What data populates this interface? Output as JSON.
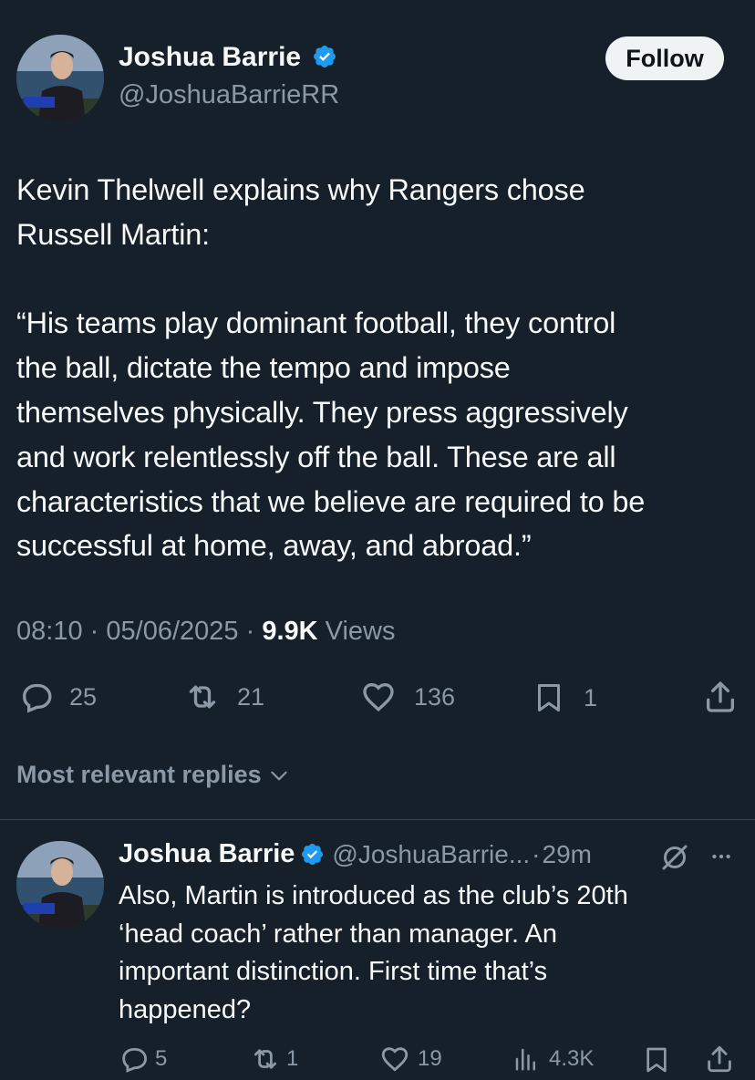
{
  "tweet": {
    "author_name": "Joshua Barrie",
    "author_handle": "@JoshuaBarrieRR",
    "follow_label": "Follow",
    "text": "Kevin Thelwell explains why Rangers chose\nRussell Martin:\n\n“His teams play dominant football, they control\nthe ball, dictate the tempo and impose\nthemselves physically. They press aggressively\nand work relentlessly off the ball. These are all\ncharacteristics that we believe are required to be\nsuccessful at home, away, and abroad.”",
    "time": "08:10",
    "date": "05/06/2025",
    "separator": "·",
    "views_count": "9.9K",
    "views_label": "Views",
    "replies": "25",
    "reposts": "21",
    "likes": "136",
    "bookmarks": "1",
    "avatar_caption": "Joshua Barrie"
  },
  "replies_filter": {
    "label": "Most relevant replies"
  },
  "reply": {
    "author_name": "Joshua Barrie",
    "author_handle": "@JoshuaBarrie...",
    "separator": "·",
    "time": "29m",
    "text": "Also, Martin is introduced as the club’s 20th\n‘head coach’ rather than manager. An\nimportant distinction. First time that’s\nhappened?",
    "replies": "5",
    "reposts": "1",
    "likes": "19",
    "views": "4.3K"
  },
  "colors": {
    "background": "#15202b",
    "text_primary": "#f7f9f9",
    "text_secondary": "#8b98a5",
    "verified_blue": "#1d9bf0",
    "divider": "#38444d",
    "button_bg": "#eff3f4"
  }
}
